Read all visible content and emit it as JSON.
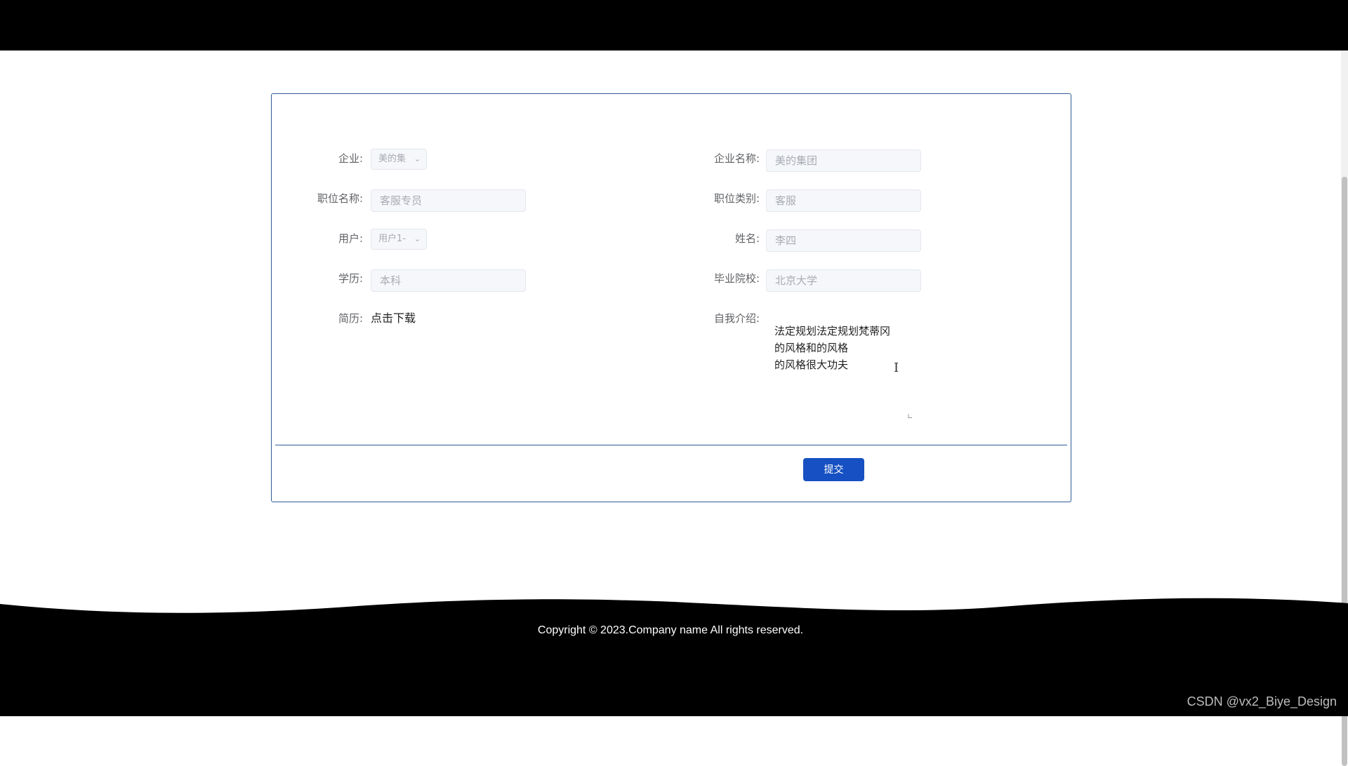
{
  "form": {
    "company_label": "企业:",
    "company_select_value": "美的集",
    "company_name_label": "企业名称:",
    "company_name_value": "美的集团",
    "job_title_label": "职位名称:",
    "job_title_value": "客服专员",
    "job_category_label": "职位类别:",
    "job_category_value": "客服",
    "user_label": "用户:",
    "user_select_value": "用户1-",
    "name_label": "姓名:",
    "name_value": "李四",
    "education_label": "学历:",
    "education_value": "本科",
    "school_label": "毕业院校:",
    "school_value": "北京大学",
    "resume_label": "简历:",
    "resume_link": "点击下载",
    "intro_label": "自我介绍:",
    "intro_value": "法定规划法定规划梵蒂冈\n的风格和的风格\n的风格很大功夫",
    "submit_label": "提交"
  },
  "footer": {
    "copyright": "Copyright © 2023.Company name All rights reserved."
  },
  "watermark": "CSDN @vx2_Biye_Design",
  "icons": {
    "chevron": "chevron-down-icon",
    "text_cursor": "text-cursor-icon"
  },
  "colors": {
    "topbar": "#000000",
    "card_border": "#2f5c96",
    "submit_button": "#1650c2",
    "footer": "#000000"
  }
}
